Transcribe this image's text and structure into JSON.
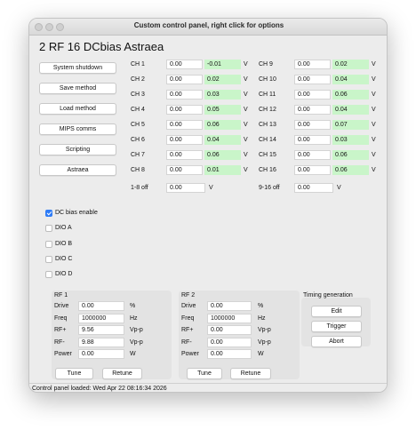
{
  "window": {
    "title": "Custom control panel, right click for options"
  },
  "heading": "2 RF 16 DCbias Astraea",
  "buttons": [
    "System shutdown",
    "Save method",
    "Load method",
    "MIPS comms",
    "Scripting",
    "Astraea"
  ],
  "channels_left": [
    {
      "label": "CH 1",
      "set": "0.00",
      "read": "-0.01"
    },
    {
      "label": "CH 2",
      "set": "0.00",
      "read": "0.02"
    },
    {
      "label": "CH 3",
      "set": "0.00",
      "read": "0.03"
    },
    {
      "label": "CH 4",
      "set": "0.00",
      "read": "0.05"
    },
    {
      "label": "CH 5",
      "set": "0.00",
      "read": "0.06"
    },
    {
      "label": "CH 6",
      "set": "0.00",
      "read": "0.04"
    },
    {
      "label": "CH 7",
      "set": "0.00",
      "read": "0.06"
    },
    {
      "label": "CH 8",
      "set": "0.00",
      "read": "0.01"
    }
  ],
  "channels_right": [
    {
      "label": "CH 9",
      "set": "0.00",
      "read": "0.02"
    },
    {
      "label": "CH 10",
      "set": "0.00",
      "read": "0.04"
    },
    {
      "label": "CH 11",
      "set": "0.00",
      "read": "0.06"
    },
    {
      "label": "CH 12",
      "set": "0.00",
      "read": "0.04"
    },
    {
      "label": "CH 13",
      "set": "0.00",
      "read": "0.07"
    },
    {
      "label": "CH 14",
      "set": "0.00",
      "read": "0.03"
    },
    {
      "label": "CH 15",
      "set": "0.00",
      "read": "0.06"
    },
    {
      "label": "CH 16",
      "set": "0.00",
      "read": "0.06"
    }
  ],
  "unit_v": "V",
  "off_left": {
    "label": "1-8 off",
    "value": "0.00",
    "unit": "V"
  },
  "off_right": {
    "label": "9-16 off",
    "value": "0.00",
    "unit": "V"
  },
  "checkboxes": [
    {
      "label": "DC bias enable",
      "checked": true
    },
    {
      "label": "DIO A",
      "checked": false
    },
    {
      "label": "DIO B",
      "checked": false
    },
    {
      "label": "DIO C",
      "checked": false
    },
    {
      "label": "DIO D",
      "checked": false
    }
  ],
  "rf1": {
    "title": "RF 1",
    "rows": [
      {
        "label": "Drive",
        "value": "0.00",
        "unit": "%"
      },
      {
        "label": "Freq",
        "value": "1000000",
        "unit": "Hz"
      },
      {
        "label": "RF+",
        "value": "9.56",
        "unit": "Vp-p"
      },
      {
        "label": "RF-",
        "value": "9.88",
        "unit": "Vp-p"
      },
      {
        "label": "Power",
        "value": "0.00",
        "unit": "W"
      }
    ],
    "tune": "Tune",
    "retune": "Retune"
  },
  "rf2": {
    "title": "RF 2",
    "rows": [
      {
        "label": "Drive",
        "value": "0.00",
        "unit": "%"
      },
      {
        "label": "Freq",
        "value": "1000000",
        "unit": "Hz"
      },
      {
        "label": "RF+",
        "value": "0.00",
        "unit": "Vp-p"
      },
      {
        "label": "RF-",
        "value": "0.00",
        "unit": "Vp-p"
      },
      {
        "label": "Power",
        "value": "0.00",
        "unit": "W"
      }
    ],
    "tune": "Tune",
    "retune": "Retune"
  },
  "timing": {
    "title": "Timing generation",
    "edit": "Edit",
    "trigger": "Trigger",
    "abort": "Abort"
  },
  "status": "Control panel loaded: Wed Apr 22 08:16:34 2026",
  "colors": {
    "readback_bg": "#c9f5c9",
    "check_accent": "#2f7cf6"
  }
}
